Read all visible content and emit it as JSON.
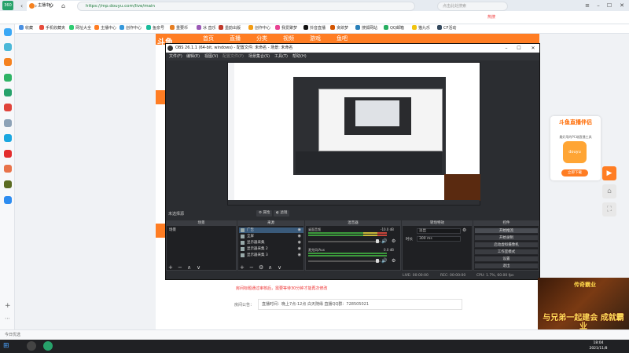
{
  "browser": {
    "logo_text": "360",
    "tab_title": "主播中心",
    "url": "https://mp.douyu.com/live/main",
    "search_placeholder": "点击此处搜索",
    "hot_label": "热搜",
    "bookmarks": [
      "收藏",
      "手机收藏夹",
      "网址大全",
      "主播中心",
      "创作中心",
      "鱼泉号",
      "重要币",
      "冰 直乐",
      "墨韵出版",
      "创作中心",
      "我爱聚梦",
      "抖音直播",
      "贪欲梦",
      "搜狐网站",
      "QQ邮箱",
      "猫九乐",
      "CF活动"
    ]
  },
  "douyu": {
    "logo": "斗鱼",
    "nav": [
      "首页",
      "直播",
      "分类",
      "视频",
      "游戏",
      "鱼吧"
    ],
    "notice": "房间标题通过审核后，需要等待30分钟才能再次修改",
    "announce_label": "房间公告：",
    "announce_text": "直播时间：晚上7点-12点 白天随缘  直播QQ群：728505021"
  },
  "ad": {
    "title": "斗鱼直播伴侣",
    "subtitle": "最好用的PC端直播工具",
    "icon_text": "douyu",
    "button": "立即下载"
  },
  "obs": {
    "title": "OBS 26.1.1 (64-bit, windows) - 配置文件: 未命名 - 场景: 未命名",
    "menu": [
      "文件(F)",
      "编辑(E)",
      "视图(V)",
      "配置文件(P)",
      "场景集合(S)",
      "工具(T)",
      "帮助(H)"
    ],
    "current_scene": "未选择源",
    "props_btn": "属性",
    "filter_btn": "滤镜",
    "docks": {
      "scenes": "场景",
      "sources": "来源",
      "mixer": "混音器",
      "transitions": "转场特效",
      "controls": "控件"
    },
    "scenes": [
      "场景"
    ],
    "sources": [
      "广告",
      "全屏",
      "显示器采集",
      "显示器采集 2",
      "显示器采集 3"
    ],
    "mixer": [
      {
        "name": "桌面音频",
        "value": "-10.0 dB"
      },
      {
        "name": "麦克风/Aux",
        "value": "0.0 dB"
      }
    ],
    "transition": {
      "type": "淡出",
      "duration_label": "时长",
      "duration": "300 ms"
    },
    "controls": [
      "开始推流",
      "开始录制",
      "启动虚拟摄像机",
      "工作室模式",
      "设置",
      "退出"
    ],
    "status": {
      "live": "LIVE: 00:00:00",
      "rec": "REC: 00:00:00",
      "cpu": "CPU: 1.7%, 60.00 fps"
    }
  },
  "game_ad": {
    "title": "传奇霸业",
    "slogan": "与兄弟一起建会 成就霸业"
  },
  "statusbar": {
    "text": "今日优选"
  },
  "taskbar": {
    "time": "18:04",
    "date": "2021/11/8"
  }
}
